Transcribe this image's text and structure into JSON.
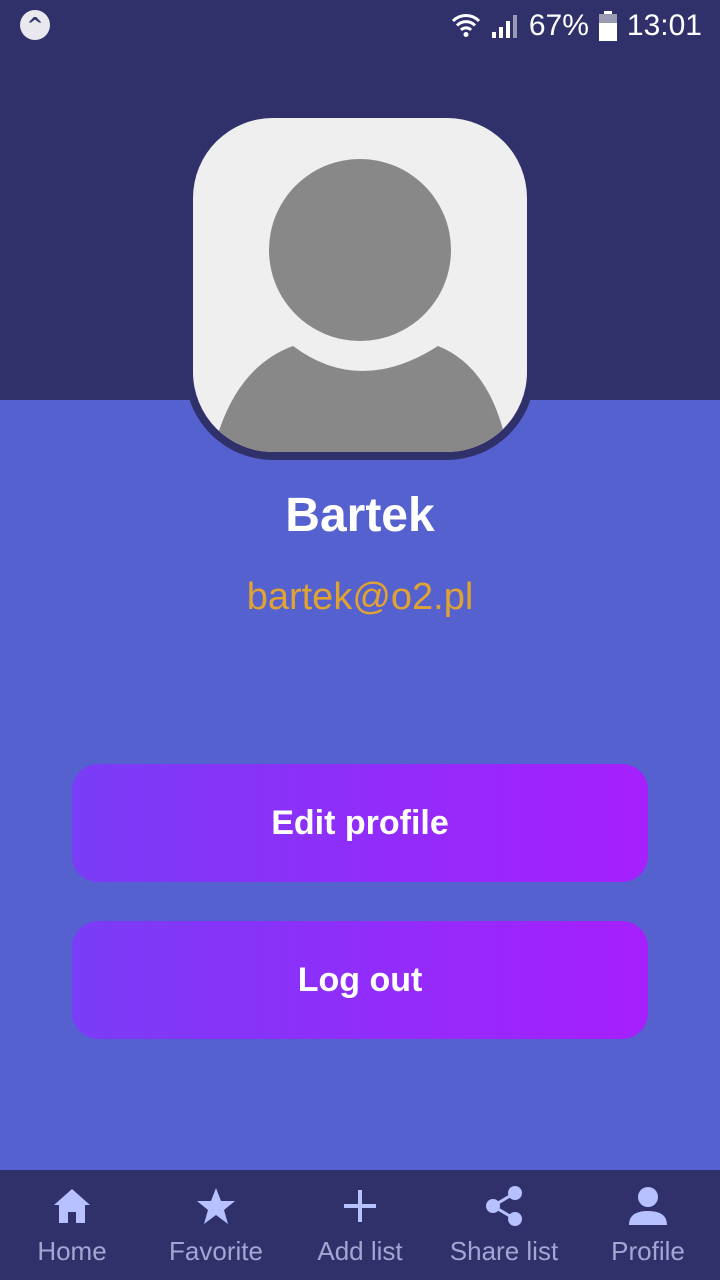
{
  "status_bar": {
    "app_icon": "^",
    "battery_percent": "67%",
    "time": "13:01"
  },
  "profile": {
    "name": "Bartek",
    "email": "bartek@o2.pl"
  },
  "actions": {
    "edit_label": "Edit profile",
    "logout_label": "Log out"
  },
  "nav": {
    "items": [
      {
        "label": "Home",
        "icon": "home-icon"
      },
      {
        "label": "Favorite",
        "icon": "star-icon"
      },
      {
        "label": "Add list",
        "icon": "plus-icon"
      },
      {
        "label": "Share list",
        "icon": "share-icon"
      },
      {
        "label": "Profile",
        "icon": "person-icon"
      }
    ]
  },
  "colors": {
    "header_bg": "#30316b",
    "body_bg": "#5561cf",
    "email": "#e0a332",
    "button_start": "#7a3cf6",
    "button_end": "#a61ffd",
    "nav_icon": "#b7c1ff",
    "nav_label": "#a3a6d3"
  }
}
